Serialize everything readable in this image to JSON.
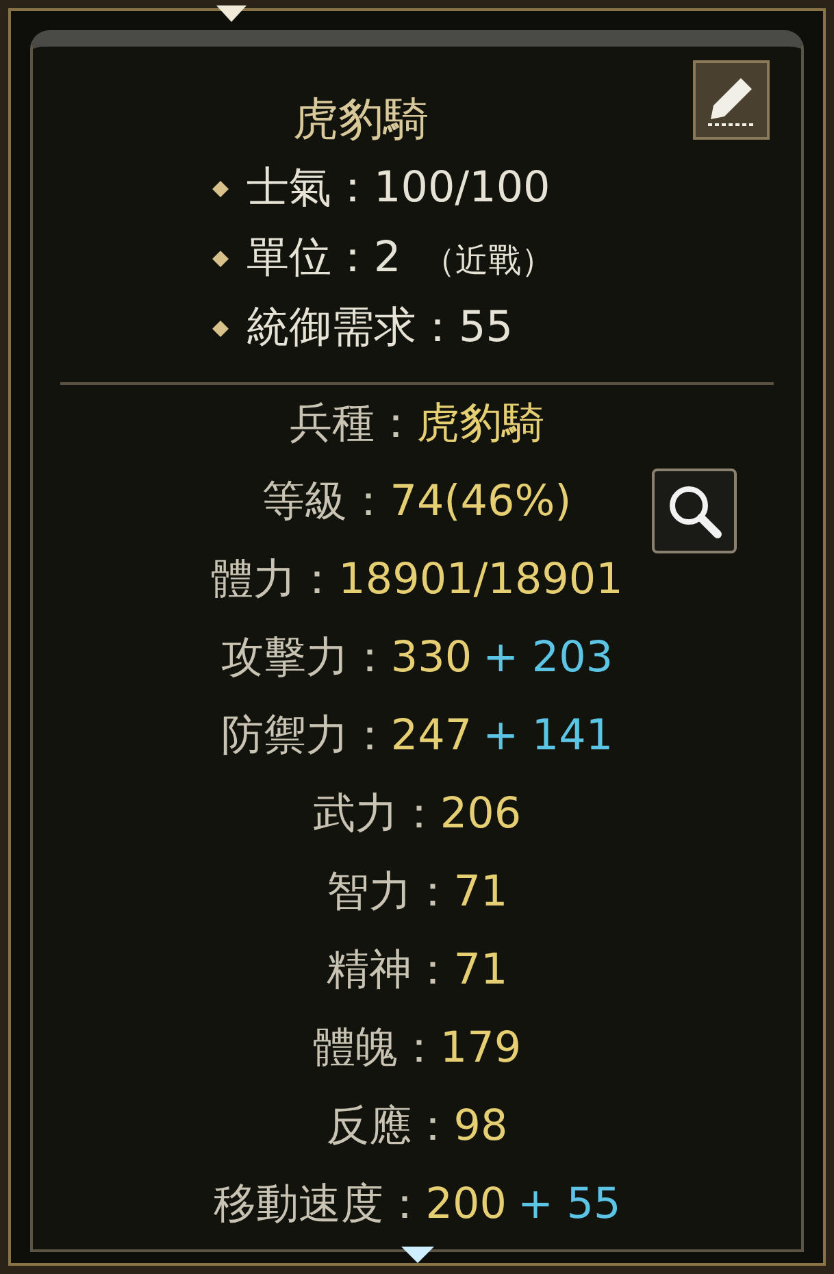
{
  "unit_name": "虎豹騎",
  "summary": [
    {
      "label": "士氣：",
      "value": "100/100"
    },
    {
      "label": "單位：",
      "value": "2",
      "note": "（近戰）"
    },
    {
      "label": "統御需求：",
      "value": "55"
    }
  ],
  "stats": [
    {
      "label": "兵種：",
      "value": "虎豹騎",
      "kind": "plain"
    },
    {
      "label": "等級：",
      "value": "74(46%)",
      "kind": "level"
    },
    {
      "label": "體力：",
      "value": "18901/18901",
      "kind": "plain"
    },
    {
      "label": "攻擊力：",
      "value": "330",
      "bonus": "+ 203",
      "kind": "plain"
    },
    {
      "label": "防禦力：",
      "value": "247",
      "bonus": "+ 141",
      "kind": "plain"
    },
    {
      "label": "武力：",
      "value": "206",
      "kind": "plain"
    },
    {
      "label": "智力：",
      "value": "71",
      "kind": "plain"
    },
    {
      "label": "精神：",
      "value": "71",
      "kind": "plain"
    },
    {
      "label": "體魄：",
      "value": "179",
      "kind": "plain"
    },
    {
      "label": "反應：",
      "value": "98",
      "kind": "plain"
    },
    {
      "label": "移動速度：",
      "value": "200",
      "bonus": "+ 55",
      "kind": "plain"
    }
  ]
}
